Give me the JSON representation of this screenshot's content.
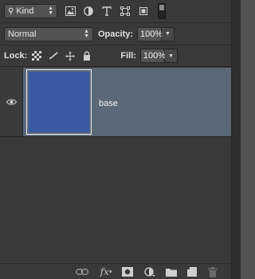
{
  "filter": {
    "kind_label": "Kind",
    "filter_icons": [
      "image-filter-icon",
      "adjustment-filter-icon",
      "type-filter-icon",
      "shape-filter-icon",
      "smart-object-filter-icon"
    ]
  },
  "blend": {
    "mode": "Normal",
    "opacity_label": "Opacity:",
    "opacity_value": "100%"
  },
  "lock": {
    "label": "Lock:",
    "fill_label": "Fill:",
    "fill_value": "100%"
  },
  "layers": [
    {
      "name": "base",
      "visible": true,
      "selected": true,
      "thumb_color": "#3b5aa3"
    }
  ],
  "colors": {
    "panel_bg": "#393939",
    "selected_row": "#5a6877",
    "accent_blue": "#3b5aa3"
  },
  "bottom_icons": [
    "link-layers-icon",
    "fx-icon",
    "layer-mask-icon",
    "adjustment-layer-icon",
    "new-group-icon",
    "new-layer-icon",
    "delete-layer-icon"
  ]
}
